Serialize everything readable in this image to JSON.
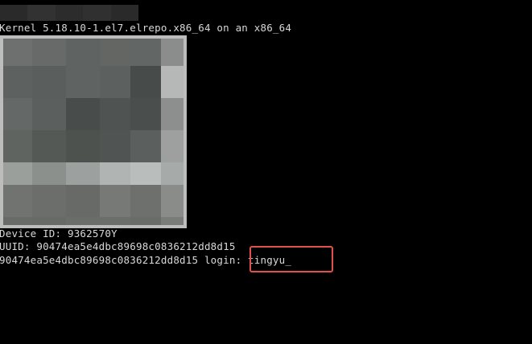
{
  "colors": {
    "background": "#000000",
    "text": "#d8d8d8",
    "highlight": "#e0504d",
    "qr_frame": "#bdbdbd"
  },
  "topbar_blocks": [
    "#2a2a2a",
    "#323232",
    "#2c2c2c",
    "#303030",
    "#2a2a2a"
  ],
  "terminal": {
    "kernel_line": "Kernel 5.18.10-1.el7.elrepo.x86_64 on an x86_64",
    "device_id_line": "Device ID: 9362570Y",
    "uuid_line": "UUID: 90474ea5e4dbc89698c0836212dd8d15",
    "login_prompt": "90474ea5e4dbc89698c0836212dd8d15 login: ",
    "typed_username": "tingyu",
    "cursor": "_"
  },
  "qr_image": {
    "alt": "pixelated QR code",
    "cols": [
      0,
      36,
      78,
      120,
      158,
      196,
      224
    ],
    "rows": [
      0,
      34,
      74,
      114,
      154,
      182,
      222,
      232
    ],
    "colors": [
      [
        "#6e706f",
        "#676a68",
        "#5f6361",
        "#646664",
        "#626664",
        "#8a8d8b"
      ],
      [
        "#5d615f",
        "#5a5e5c",
        "#5f6462",
        "#5c605e",
        "#474b49",
        "#b6b8b7"
      ],
      [
        "#646866",
        "#5b5f5d",
        "#484c4a",
        "#4f5351",
        "#4a4e4c",
        "#8c8f8d"
      ],
      [
        "#5f6461",
        "#545956",
        "#4d524f",
        "#505452",
        "#5b5f5d",
        "#9ea09f"
      ],
      [
        "#9a9f9c",
        "#8b908d",
        "#9ca09e",
        "#b0b4b2",
        "#b9bdbb",
        "#a6aaa8"
      ],
      [
        "#717371",
        "#6c6e6c",
        "#686a68",
        "#777977",
        "#6e706e",
        "#8a8c8a"
      ],
      [
        "#696b69",
        "#686a68",
        "#6b6d6b",
        "#6c6e6c",
        "#6a6c6a",
        "#7a7c7a"
      ]
    ]
  }
}
